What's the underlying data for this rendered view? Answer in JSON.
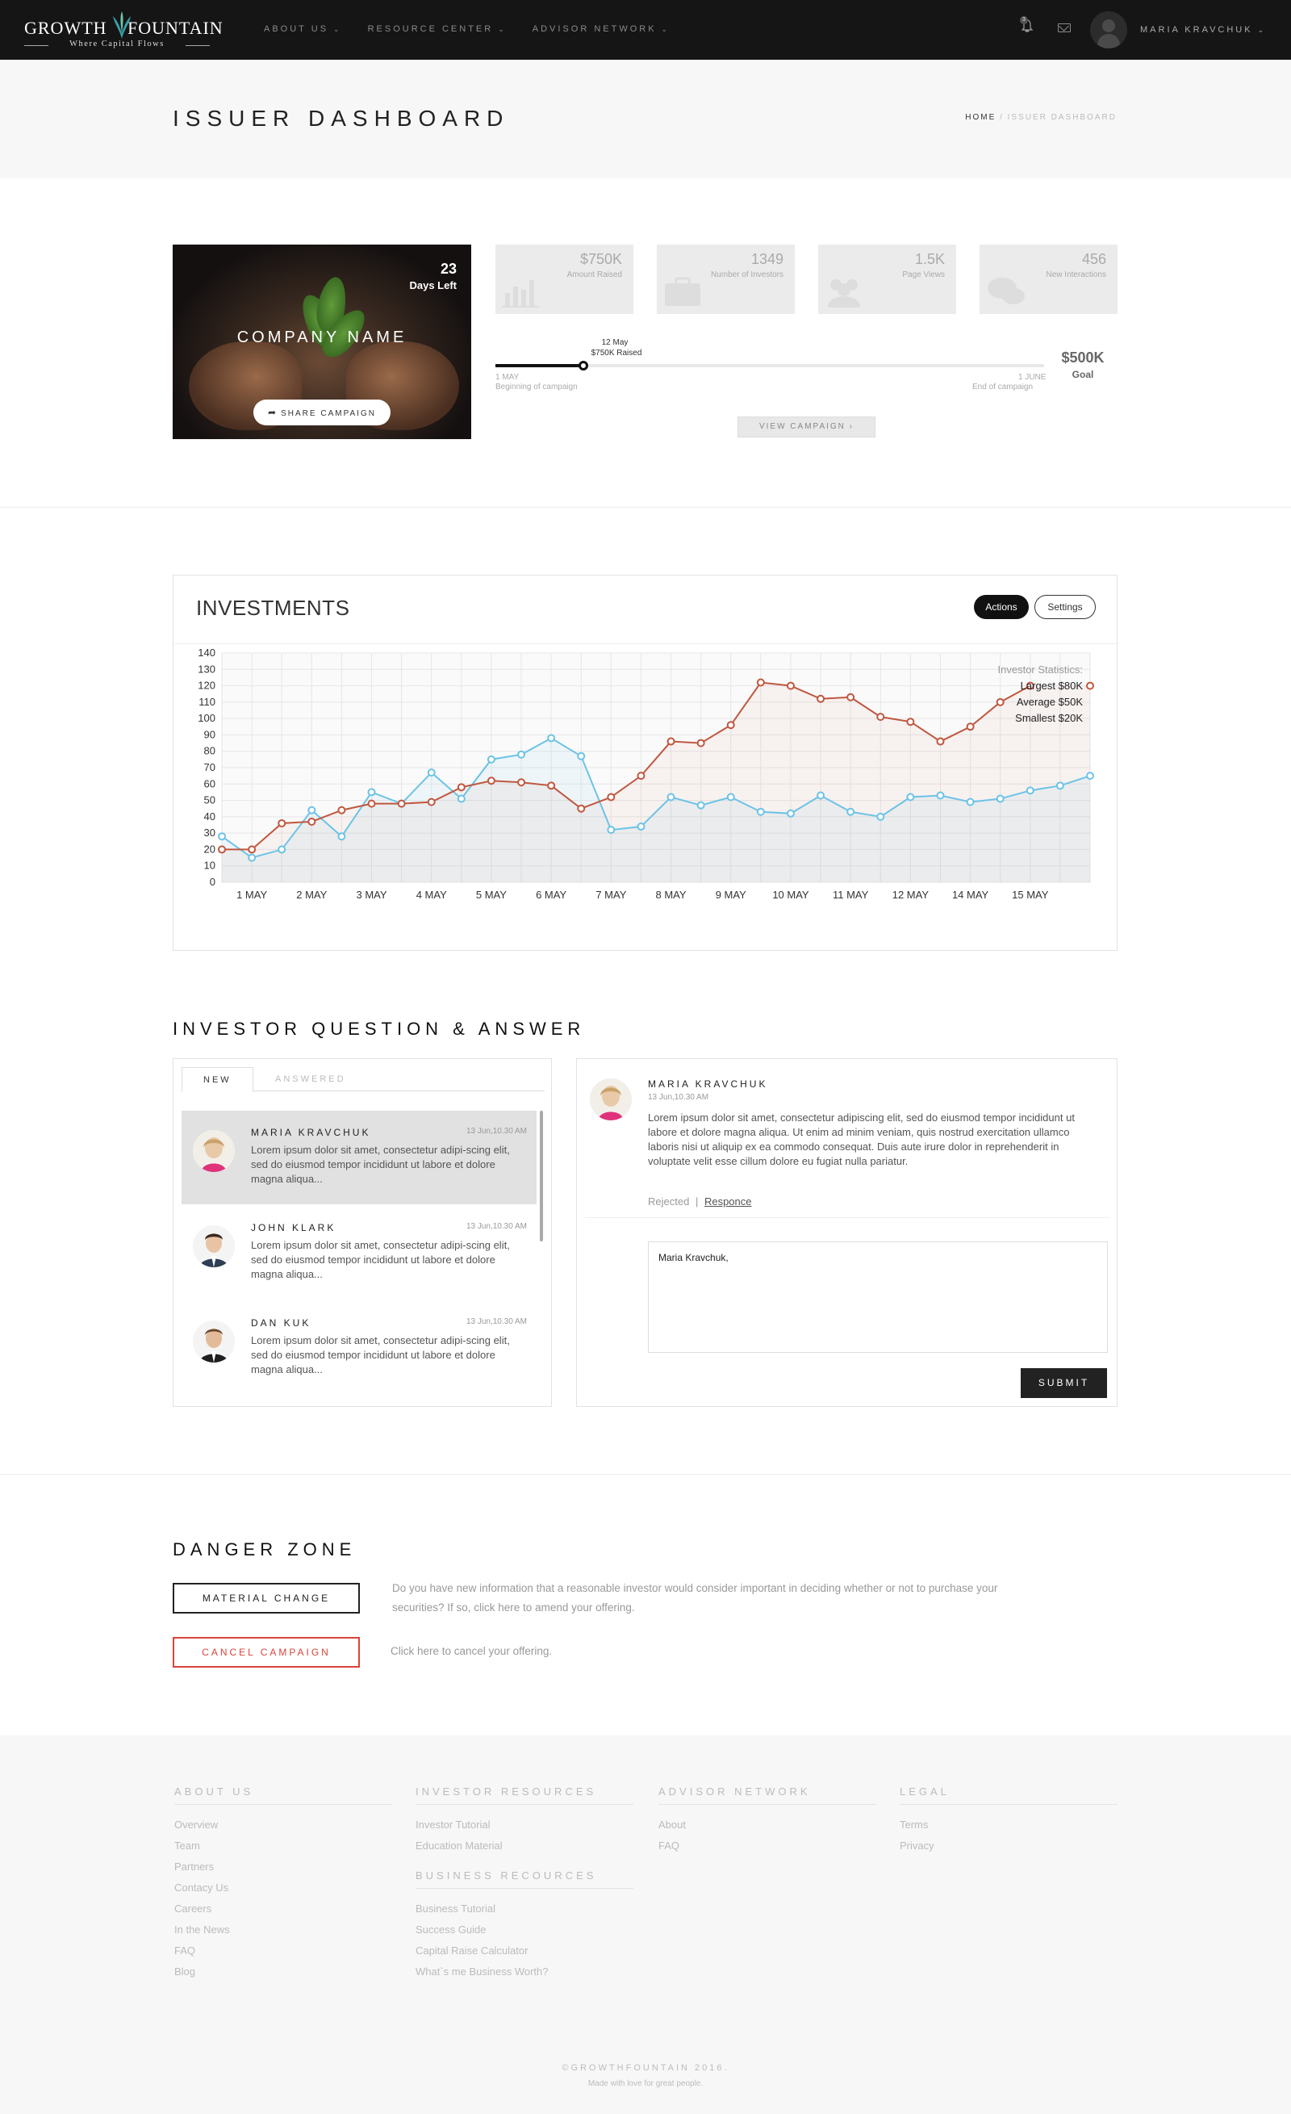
{
  "nav": {
    "logo_left": "GROWTH",
    "logo_right": "FOUNTAIN",
    "logo_tagline": "Where Capital Flows",
    "menu": [
      "ABOUT US",
      "RESOURCE CENTER",
      "ADVISOR NETWORK"
    ],
    "notification_count": "3",
    "user_name": "MARIA KRAVCHUK"
  },
  "header": {
    "title": "ISSUER DASHBOARD",
    "breadcrumb_home": "HOME",
    "breadcrumb_sep": "/",
    "breadcrumb_current": "ISSUER DASHBOARD"
  },
  "campaign": {
    "days_left_value": "23",
    "days_left_label": "Days Left",
    "company_name": "COMPANY NAME",
    "share_label": "SHARE CAMPAIGN",
    "stats": [
      {
        "value": "$750K",
        "label": "Amount Raised",
        "icon": "bar-chart-icon"
      },
      {
        "value": "1349",
        "label": "Number of  Investors",
        "icon": "briefcase-icon"
      },
      {
        "value": "1.5K",
        "label": "Page Views",
        "icon": "users-icon"
      },
      {
        "value": "456",
        "label": "New Interactions",
        "icon": "chat-icon"
      }
    ],
    "progress": {
      "fraction": 0.16,
      "current_date": "12 May",
      "current_raised": "$750K Raised",
      "start_date": "1 MAY",
      "start_label": "Beginning of campaign",
      "end_date": "1 JUNE",
      "end_label": "End of campaign"
    },
    "goal_value": "$500K",
    "goal_label": "Goal",
    "view_label": "VIEW CAMPAIGN ›"
  },
  "investments": {
    "title": "INVESTMENTS",
    "actions_label": "Actions",
    "settings_label": "Settings",
    "stats_title": "Investor Statistics:",
    "stats_lines": [
      "Largest $80K",
      "Average $50K",
      "Smallest $20K"
    ]
  },
  "chart_data": {
    "type": "line",
    "title": "INVESTMENTS",
    "xlabel": "",
    "ylabel": "",
    "ylim": [
      0,
      140
    ],
    "yticks": [
      0,
      10,
      20,
      30,
      40,
      50,
      60,
      70,
      80,
      90,
      100,
      110,
      120,
      130,
      140
    ],
    "grid": true,
    "x_tick_labels": [
      "1 MAY",
      "2 MAY",
      "3 MAY",
      "4 MAY",
      "5 MAY",
      "6 MAY",
      "7 MAY",
      "8 MAY",
      "9 MAY",
      "10 MAY",
      "11 MAY",
      "12 MAY",
      "14 MAY",
      "15 MAY"
    ],
    "colors": {
      "blue": "#6cc3e6",
      "red": "#c0573f"
    },
    "series": [
      {
        "color": "#6cc3e6",
        "values": [
          28,
          15,
          20,
          44,
          28,
          55,
          48,
          67,
          51,
          75,
          78,
          88,
          77,
          32,
          34,
          52,
          47,
          52,
          43,
          42,
          53,
          43,
          40,
          52,
          53,
          49,
          51,
          56,
          59,
          65
        ]
      },
      {
        "color": "#c0573f",
        "values": [
          20,
          20,
          36,
          37,
          44,
          48,
          48,
          49,
          58,
          62,
          61,
          59,
          45,
          52,
          65,
          86,
          85,
          96,
          122,
          120,
          112,
          113,
          101,
          98,
          86,
          95,
          110,
          120,
          null,
          120
        ]
      }
    ]
  },
  "qa": {
    "title": "INVESTOR QUESTION & ANSWER",
    "tab_new": "NEW",
    "tab_answered": "ANSWERED",
    "items": [
      {
        "name": "MARIA KRAVCHUK",
        "time": "13 Jun,10.30 AM",
        "text": "Lorem ipsum dolor sit amet, consectetur adipi-scing elit, sed do eiusmod tempor incididunt ut labore et dolore magna aliqua..."
      },
      {
        "name": "JOHN KLARK",
        "time": "13 Jun,10.30 AM",
        "text": "Lorem ipsum dolor sit amet, consectetur adipi-scing elit, sed do eiusmod tempor incididunt ut labore et dolore magna aliqua..."
      },
      {
        "name": "DAN KUK",
        "time": "13 Jun,10.30 AM",
        "text": "Lorem ipsum dolor sit amet, consectetur adipi-scing elit, sed do eiusmod tempor incididunt ut labore et dolore magna aliqua..."
      }
    ],
    "detail": {
      "name": "MARIA KRAVCHUK",
      "time": "13 Jun,10.30 AM",
      "text": "Lorem ipsum dolor sit amet, consectetur adipiscing elit, sed do eiusmod tempor incididunt ut labore et dolore magna aliqua. Ut enim ad minim veniam, quis nostrud exercitation ullamco laboris nisi ut aliquip ex ea commodo consequat. Duis aute irure dolor in reprehenderit in voluptate velit esse cillum dolore eu fugiat nulla pariatur.",
      "status_rejected": "Rejected",
      "status_sep": "|",
      "status_response": "Responce",
      "reply_value": "Maria Kravchuk,",
      "submit_label": "SUBMIT"
    }
  },
  "danger": {
    "title": "DANGER ZONE",
    "material_label": "MATERIAL CHANGE",
    "material_text": "Do you have new information that a reasonable investor would consider important in deciding whether or not to purchase your securities?  If so, click here to amend your offering.",
    "cancel_label": "CANCEL CAMPAIGN",
    "cancel_text": "Click here to cancel your offering."
  },
  "footer": {
    "about_head": "ABOUT US",
    "about_links": [
      "Overview",
      "Team",
      "Partners",
      "Contacy Us",
      "Careers",
      "In the News",
      "FAQ",
      "Blog"
    ],
    "investor_head": "INVESTOR RESOURCES",
    "investor_links": [
      "Investor Tutorial",
      "Education Material"
    ],
    "business_head": "BUSINESS RECOURCES",
    "business_links": [
      "Business Tutorial",
      "Success Guide",
      "Capital Raise Calculator",
      "What`s me Business Worth?"
    ],
    "advisor_head": "ADVISOR NETWORK",
    "advisor_links": [
      "About",
      "FAQ"
    ],
    "legal_head": "LEGAL",
    "legal_links": [
      "Terms",
      "Privacy"
    ],
    "copyright": "©GROWTHFOUNTAIN 2016.",
    "made_with": "Made with love for great people."
  }
}
